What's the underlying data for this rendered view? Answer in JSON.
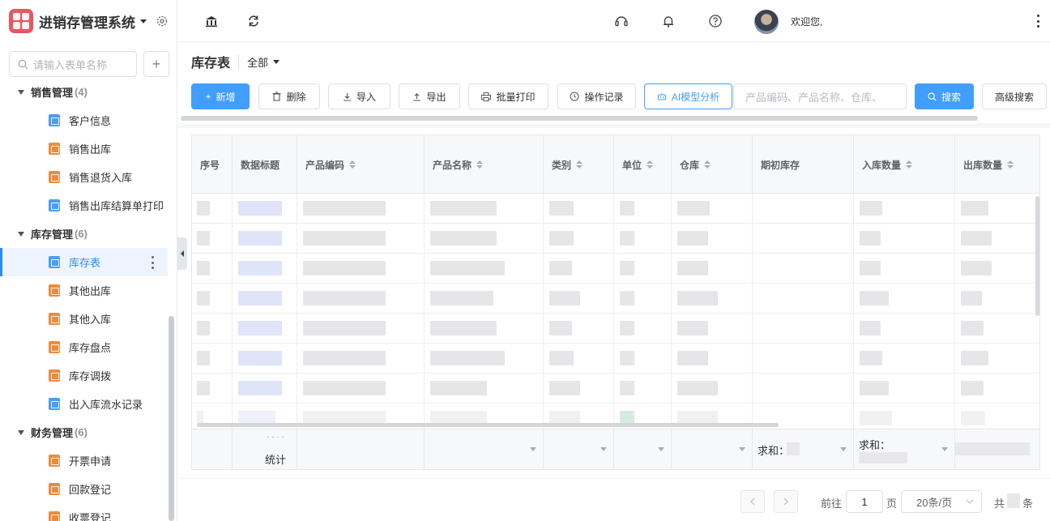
{
  "app": {
    "title": "进销存管理系统"
  },
  "sidebar": {
    "search_placeholder": "请输入表单名称",
    "add_label": "+",
    "groups": [
      {
        "label": "销售管理",
        "count": "(4)",
        "items": [
          "客户信息",
          "销售出库",
          "销售退货入库",
          "销售出库结算单打印"
        ]
      },
      {
        "label": "库存管理",
        "count": "(6)",
        "items": [
          "库存表",
          "其他出库",
          "其他入库",
          "库存盘点",
          "库存调拨",
          "出入库流水记录"
        ]
      },
      {
        "label": "财务管理",
        "count": "(6)",
        "items": [
          "开票申请",
          "回款登记",
          "收票登记"
        ]
      }
    ]
  },
  "topbar": {
    "welcome": "欢迎您,"
  },
  "page": {
    "title": "库存表",
    "view": "全部"
  },
  "toolbar": {
    "new": "新增",
    "delete": "删除",
    "import": "导入",
    "export": "导出",
    "batch_print": "批量打印",
    "op_log": "操作记录",
    "ai_analysis": "AI模型分析",
    "search_placeholder": "产品编码、产品名称、仓库、",
    "search": "搜索",
    "advanced": "高级搜索"
  },
  "table": {
    "columns": [
      "序号",
      "数据标题",
      "产品编码",
      "产品名称",
      "类别",
      "单位",
      "仓库",
      "期初库存",
      "入库数量",
      "出库数量"
    ],
    "footer": {
      "stat_label": "统计",
      "sum_label_1": "求和：",
      "sum_label_2": "求和："
    }
  },
  "pager": {
    "goto": "前往",
    "page_value": "1",
    "page_unit": "页",
    "page_size": "20条/页",
    "total_prefix": "共",
    "total_suffix": "条"
  }
}
